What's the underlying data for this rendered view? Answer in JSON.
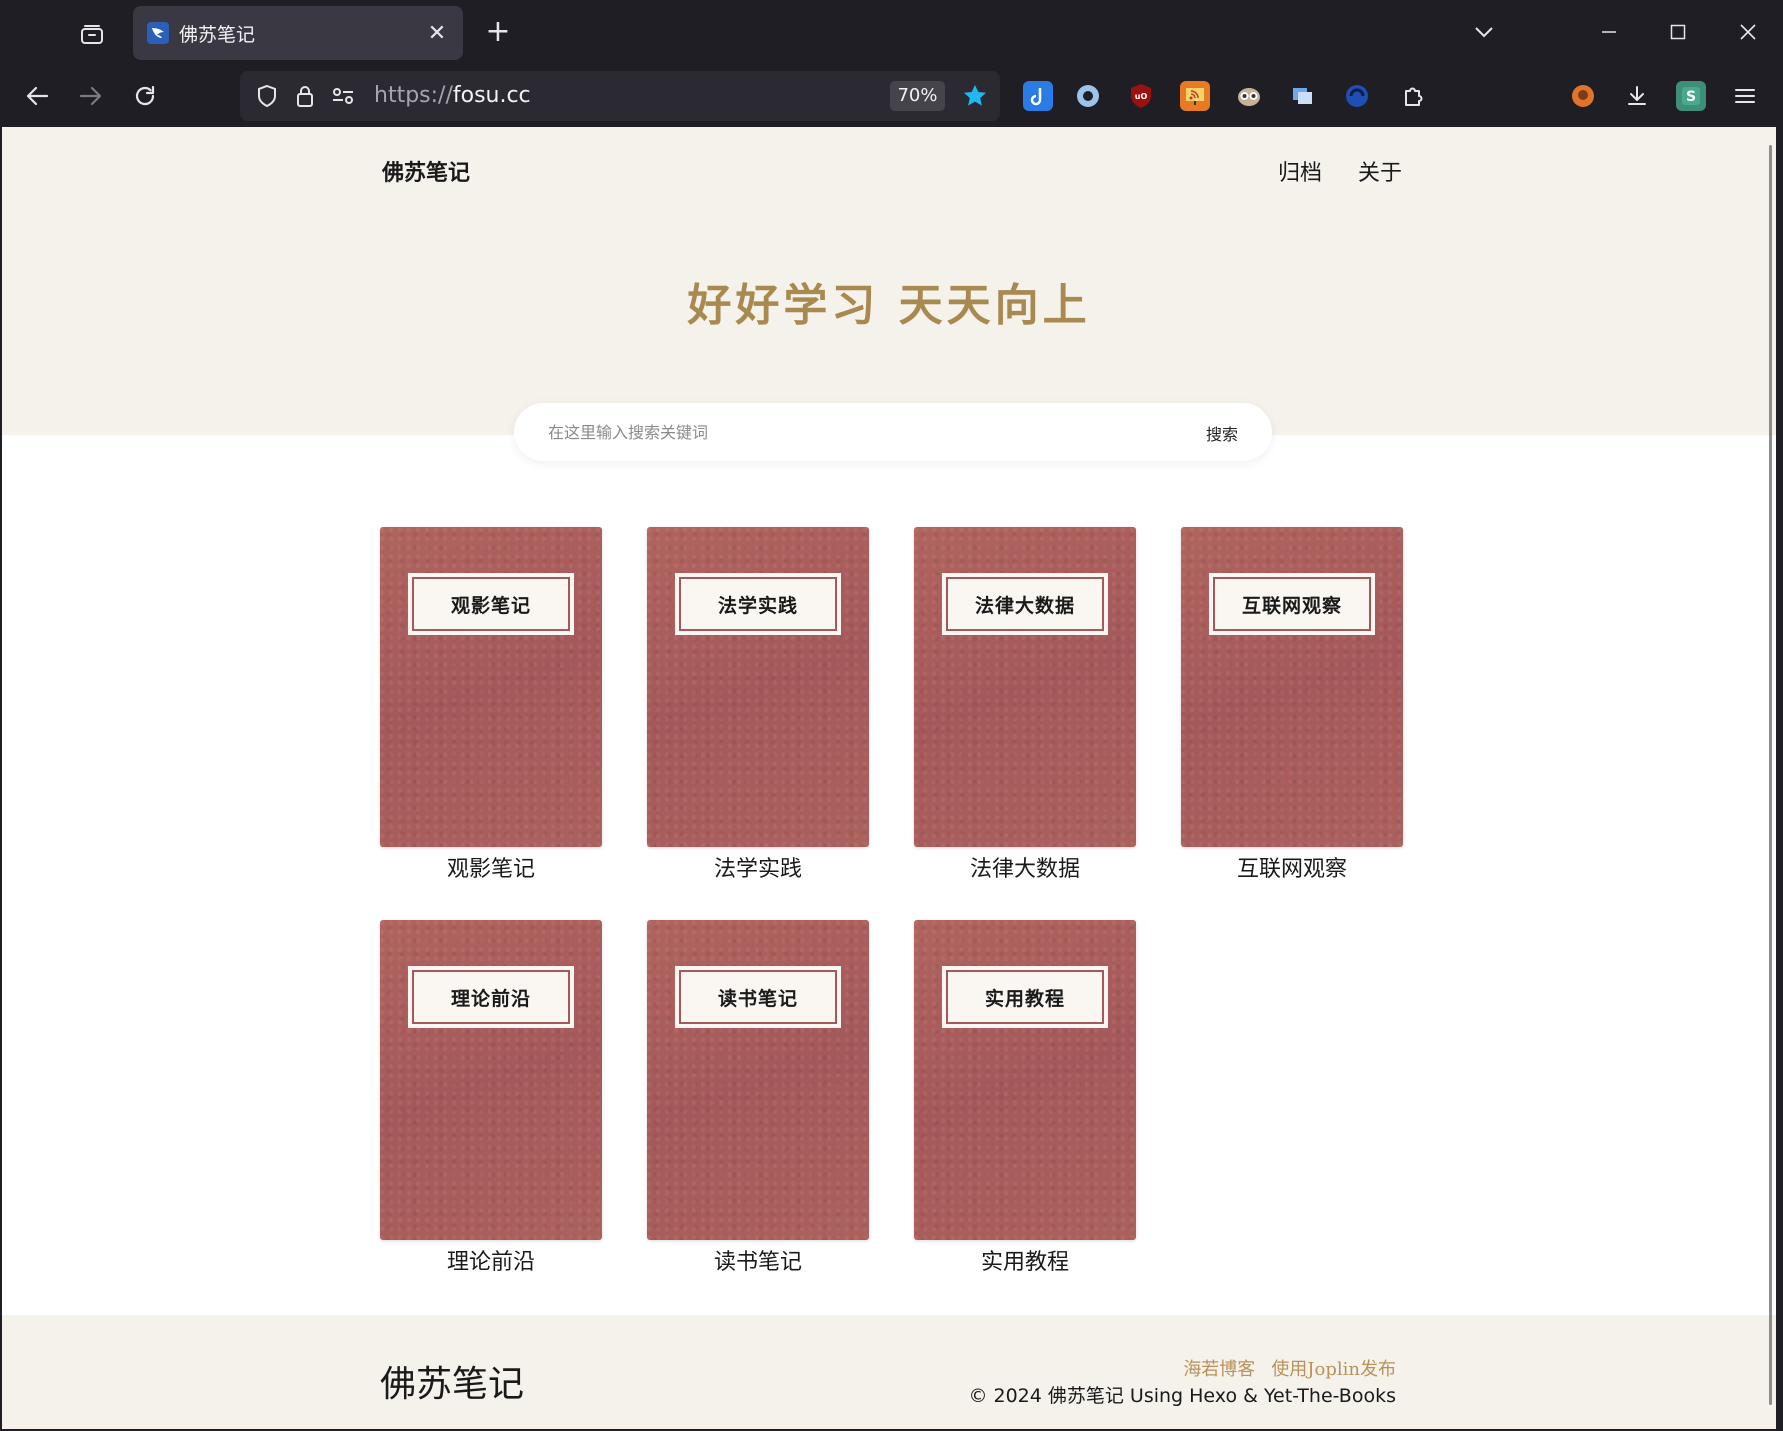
{
  "browser": {
    "tab_title": "佛苏笔记",
    "url_protocol": "https://",
    "url_host": "fosu.cc",
    "zoom": "70%"
  },
  "site": {
    "brand": "佛苏笔记",
    "nav": [
      {
        "label": "归档"
      },
      {
        "label": "关于"
      }
    ],
    "slogan": "好好学习 天天向上"
  },
  "search": {
    "placeholder": "在这里输入搜索关键词",
    "button": "搜索"
  },
  "books": [
    {
      "cover": "观影笔记",
      "caption": "观影笔记"
    },
    {
      "cover": "法学实践",
      "caption": "法学实践"
    },
    {
      "cover": "法律大数据",
      "caption": "法律大数据"
    },
    {
      "cover": "互联网观察",
      "caption": "互联网观察"
    },
    {
      "cover": "理论前沿",
      "caption": "理论前沿"
    },
    {
      "cover": "读书笔记",
      "caption": "读书笔记"
    },
    {
      "cover": "实用教程",
      "caption": "实用教程"
    }
  ],
  "footer": {
    "brand": "佛苏笔记",
    "links": [
      {
        "label": "海若博客"
      },
      {
        "label": "使用Joplin发布"
      }
    ],
    "copyright": "© 2024 佛苏笔记 Using Hexo & Yet-The-Books"
  },
  "colors": {
    "hero_bg": "#f5f2ec",
    "accent_gold": "#a8894f",
    "cover_red": "#aa5f5a",
    "link_gold": "#b8925a"
  }
}
